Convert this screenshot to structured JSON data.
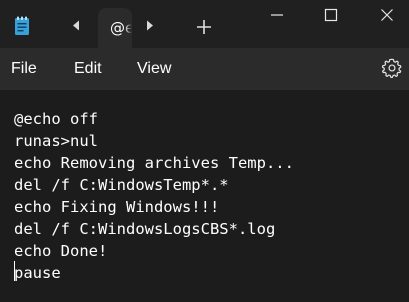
{
  "titlebar": {
    "tab_label": "@echo off",
    "icons": {
      "app": "notepad-icon",
      "back": "chevron-left-icon",
      "forward": "chevron-right-icon",
      "new_tab": "plus-icon",
      "minimize": "minimize-icon",
      "maximize": "maximize-icon",
      "close": "close-icon"
    }
  },
  "menu": {
    "file": "File",
    "edit": "Edit",
    "view": "View",
    "settings_icon": "gear-icon"
  },
  "editor": {
    "lines": [
      "@echo off",
      "runas>nul",
      "echo Removing archives Temp...",
      "del /f C:WindowsTemp*.*",
      "echo Fixing Windows!!!",
      "del /f C:WindowsLogsCBS*.log",
      "echo Done!",
      "pause"
    ]
  },
  "colors": {
    "background": "#1c1c1c",
    "titlebar": "#202020",
    "menubar": "#2b2b2b",
    "text": "#ffffff",
    "notepad_blue": "#3aa0d8"
  }
}
